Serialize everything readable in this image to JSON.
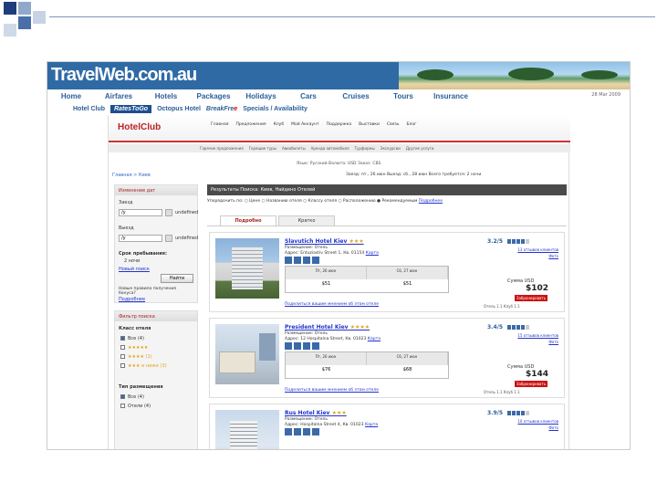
{
  "site": {
    "logo": "TravelWeb.com.au",
    "nav": [
      "Home",
      "Airfares",
      "Hotels",
      "Packages",
      "Holidays",
      "Cars",
      "Cruises",
      "Tours",
      "Insurance"
    ],
    "date": "28 Mar 2009",
    "subnav": {
      "hotel_club": "Hotel Club",
      "rates_to_go": "RatesToGo",
      "octopus": "Octopus Hotel",
      "breakfree_a": "BreakFre",
      "breakfree_b": "e",
      "specials": "Specials / Availability"
    }
  },
  "hotelclub": {
    "logo": "HotelClub",
    "menu": [
      "Главная",
      "Предложения",
      "Клуб",
      "Мой Аккаунт",
      "Поддержка",
      "Выставки",
      "Связь",
      "Блог"
    ],
    "submenu": [
      "Горячие предложения",
      "Горящие туры",
      "Авиабилеты",
      "Аренда автомобиля",
      "Турфирмы",
      "Экскурсии",
      "Другие услуги"
    ],
    "toplinks": "Язык: Русский   Валюта: USD   Заказ: CBS",
    "breadcrumb": "Главная > Киев",
    "stay_line": "Заезд: пт., 26 июн   Выезд: сб., 28 июн   Всего требуется: 2 ночи"
  },
  "sidebar": {
    "dates_title": "Изменение дат",
    "checkin_label": "Заезд",
    "checkin_value": "/y",
    "checkout_label": "Выезд",
    "checkout_value": "/y",
    "undefined1": "undefined",
    "undefined2": "undefined",
    "duration_label": "Срок пребывания:",
    "duration_value": "2 ночи",
    "new_search": "Новый поиск",
    "update_btn": "Найти",
    "note": "Новые правила получения бонуса?",
    "note_link": "Подробнее",
    "filter_title": "Фильтр поиска",
    "stars_title": "Класс отеля",
    "stars": [
      {
        "label": "Все (4)",
        "checked": true
      },
      {
        "label": "★★★★★",
        "checked": false
      },
      {
        "label": "★★★★ (1)",
        "checked": false
      },
      {
        "label": "★★★ и ниже (3)",
        "checked": false
      }
    ],
    "type_title": "Тип размещения",
    "types": [
      {
        "label": "Все (4)",
        "checked": true
      },
      {
        "label": "Отели (4)",
        "checked": false
      }
    ]
  },
  "results": {
    "header": "Результаты Поиска: Киев, Найдено Отелей",
    "sort_label": "Упорядочить по:",
    "sort_options": [
      "Цене",
      "Названию отеля",
      "Классу отеля",
      "Расположению",
      "Рекомендуемым"
    ],
    "sort_link": "Подробнее",
    "tabs": [
      "Подробно",
      "Кратко"
    ],
    "hotels": [
      {
        "name": "Slavutich Hotel Kiev",
        "stars": "★★★",
        "type": "Размещение: Отель",
        "address": "Адрес: Entuziastiv Street 1, Кв. 01154",
        "map": "Карта",
        "d1": "Пт, 26 июн",
        "d2": "Сб, 27 июн",
        "p1": "$51",
        "p2": "$51",
        "rating": "3.2/5",
        "reviews": "13 отзывов клиентов",
        "photos": "Фото",
        "sum_label": "Сумма USD",
        "sum": "$102",
        "book": "Забронировать",
        "add_review": "Поделиться вашим мнением об этом отеле",
        "share": "Отель 1.1 Клуб 1.1"
      },
      {
        "name": "President Hotel Kiev",
        "stars": "★★★★",
        "type": "Размещение: Отель",
        "address": "Адрес: 12 Hospitalna Street, Кв. 01023",
        "map": "Карта",
        "d1": "Пт, 26 июн",
        "d2": "Сб, 27 июн",
        "p1": "$76",
        "p2": "$68",
        "rating": "3.4/5",
        "reviews": "15 отзывов клиентов",
        "photos": "Фото",
        "sum_label": "Сумма USD",
        "sum": "$144",
        "book": "Забронировать",
        "add_review": "Поделиться вашим мнением об этом отеле",
        "share": "Отель 1.1 Клуб 1.1"
      },
      {
        "name": "Rus Hotel Kiev",
        "stars": "★★★",
        "type": "Размещение: Отель",
        "address": "Адрес: Hospitalna Street 4, Кв. 01023",
        "map": "Карта",
        "rating": "3.9/5",
        "reviews": "10 отзывов клиентов",
        "photos": "Фото"
      }
    ]
  }
}
